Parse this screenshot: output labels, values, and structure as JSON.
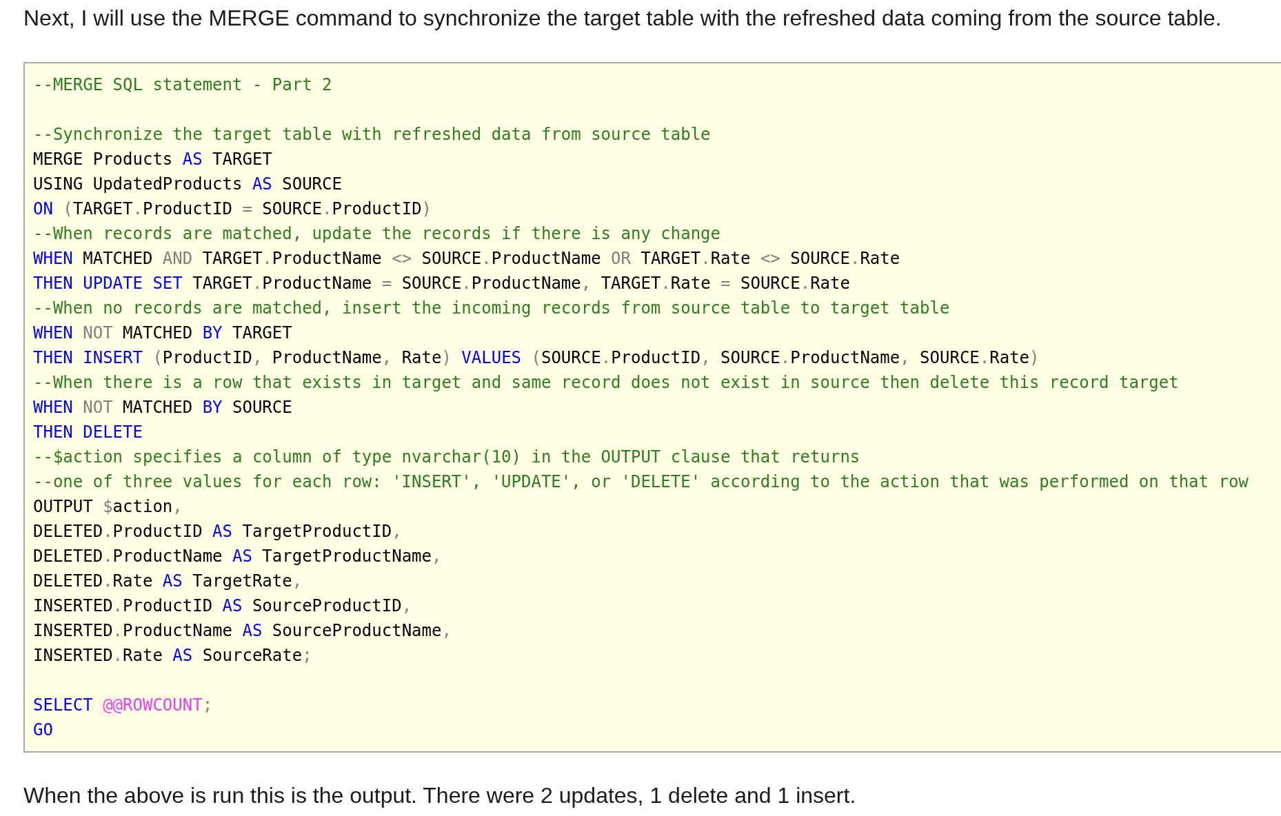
{
  "intro": "Next, I will use the MERGE command to synchronize the target table with the refreshed data coming from the source table.",
  "code_lines": [
    {
      "kind": "code",
      "tokens": [
        {
          "kind": "comment",
          "text": "--MERGE SQL statement - Part 2"
        }
      ]
    },
    {
      "kind": "blank"
    },
    {
      "kind": "code",
      "tokens": [
        {
          "kind": "comment",
          "text": "--Synchronize the target table with refreshed data from source table"
        }
      ]
    },
    {
      "kind": "code",
      "tokens": [
        {
          "kind": "plain",
          "text": "MERGE Products "
        },
        {
          "kind": "keyword",
          "text": "AS"
        },
        {
          "kind": "plain",
          "text": " TARGET"
        }
      ]
    },
    {
      "kind": "code",
      "tokens": [
        {
          "kind": "plain",
          "text": "USING UpdatedProducts "
        },
        {
          "kind": "keyword",
          "text": "AS"
        },
        {
          "kind": "plain",
          "text": " SOURCE"
        }
      ]
    },
    {
      "kind": "code",
      "tokens": [
        {
          "kind": "keyword",
          "text": "ON"
        },
        {
          "kind": "operator",
          "text": " ("
        },
        {
          "kind": "plain",
          "text": "TARGET"
        },
        {
          "kind": "operator",
          "text": "."
        },
        {
          "kind": "plain",
          "text": "ProductID "
        },
        {
          "kind": "operator",
          "text": "="
        },
        {
          "kind": "plain",
          "text": " SOURCE"
        },
        {
          "kind": "operator",
          "text": "."
        },
        {
          "kind": "plain",
          "text": "ProductID"
        },
        {
          "kind": "operator",
          "text": ")"
        }
      ]
    },
    {
      "kind": "code",
      "tokens": [
        {
          "kind": "comment",
          "text": "--When records are matched, update the records if there is any change"
        }
      ]
    },
    {
      "kind": "code",
      "tokens": [
        {
          "kind": "keyword",
          "text": "WHEN"
        },
        {
          "kind": "plain",
          "text": " MATCHED "
        },
        {
          "kind": "operator",
          "text": "AND"
        },
        {
          "kind": "plain",
          "text": " TARGET"
        },
        {
          "kind": "operator",
          "text": "."
        },
        {
          "kind": "plain",
          "text": "ProductName "
        },
        {
          "kind": "operator",
          "text": "<>"
        },
        {
          "kind": "plain",
          "text": " SOURCE"
        },
        {
          "kind": "operator",
          "text": "."
        },
        {
          "kind": "plain",
          "text": "ProductName "
        },
        {
          "kind": "operator",
          "text": "OR"
        },
        {
          "kind": "plain",
          "text": " TARGET"
        },
        {
          "kind": "operator",
          "text": "."
        },
        {
          "kind": "plain",
          "text": "Rate "
        },
        {
          "kind": "operator",
          "text": "<>"
        },
        {
          "kind": "plain",
          "text": " SOURCE"
        },
        {
          "kind": "operator",
          "text": "."
        },
        {
          "kind": "plain",
          "text": "Rate"
        }
      ]
    },
    {
      "kind": "code",
      "tokens": [
        {
          "kind": "keyword",
          "text": "THEN UPDATE SET"
        },
        {
          "kind": "plain",
          "text": " TARGET"
        },
        {
          "kind": "operator",
          "text": "."
        },
        {
          "kind": "plain",
          "text": "ProductName "
        },
        {
          "kind": "operator",
          "text": "="
        },
        {
          "kind": "plain",
          "text": " SOURCE"
        },
        {
          "kind": "operator",
          "text": "."
        },
        {
          "kind": "plain",
          "text": "ProductName"
        },
        {
          "kind": "operator",
          "text": ","
        },
        {
          "kind": "plain",
          "text": " TARGET"
        },
        {
          "kind": "operator",
          "text": "."
        },
        {
          "kind": "plain",
          "text": "Rate "
        },
        {
          "kind": "operator",
          "text": "="
        },
        {
          "kind": "plain",
          "text": " SOURCE"
        },
        {
          "kind": "operator",
          "text": "."
        },
        {
          "kind": "plain",
          "text": "Rate"
        }
      ]
    },
    {
      "kind": "code",
      "tokens": [
        {
          "kind": "comment",
          "text": "--When no records are matched, insert the incoming records from source table to target table"
        }
      ]
    },
    {
      "kind": "code",
      "tokens": [
        {
          "kind": "keyword",
          "text": "WHEN"
        },
        {
          "kind": "operator",
          "text": " NOT"
        },
        {
          "kind": "plain",
          "text": " MATCHED "
        },
        {
          "kind": "keyword",
          "text": "BY"
        },
        {
          "kind": "plain",
          "text": " TARGET"
        }
      ]
    },
    {
      "kind": "code",
      "tokens": [
        {
          "kind": "keyword",
          "text": "THEN INSERT"
        },
        {
          "kind": "operator",
          "text": " ("
        },
        {
          "kind": "plain",
          "text": "ProductID"
        },
        {
          "kind": "operator",
          "text": ","
        },
        {
          "kind": "plain",
          "text": " ProductName"
        },
        {
          "kind": "operator",
          "text": ","
        },
        {
          "kind": "plain",
          "text": " Rate"
        },
        {
          "kind": "operator",
          "text": ")"
        },
        {
          "kind": "keyword",
          "text": " VALUES"
        },
        {
          "kind": "operator",
          "text": " ("
        },
        {
          "kind": "plain",
          "text": "SOURCE"
        },
        {
          "kind": "operator",
          "text": "."
        },
        {
          "kind": "plain",
          "text": "ProductID"
        },
        {
          "kind": "operator",
          "text": ","
        },
        {
          "kind": "plain",
          "text": " SOURCE"
        },
        {
          "kind": "operator",
          "text": "."
        },
        {
          "kind": "plain",
          "text": "ProductName"
        },
        {
          "kind": "operator",
          "text": ","
        },
        {
          "kind": "plain",
          "text": " SOURCE"
        },
        {
          "kind": "operator",
          "text": "."
        },
        {
          "kind": "plain",
          "text": "Rate"
        },
        {
          "kind": "operator",
          "text": ")"
        }
      ]
    },
    {
      "kind": "code",
      "tokens": [
        {
          "kind": "comment",
          "text": "--When there is a row that exists in target and same record does not exist in source then delete this record target"
        }
      ]
    },
    {
      "kind": "code",
      "tokens": [
        {
          "kind": "keyword",
          "text": "WHEN"
        },
        {
          "kind": "operator",
          "text": " NOT"
        },
        {
          "kind": "plain",
          "text": " MATCHED "
        },
        {
          "kind": "keyword",
          "text": "BY"
        },
        {
          "kind": "plain",
          "text": " SOURCE"
        }
      ]
    },
    {
      "kind": "code",
      "tokens": [
        {
          "kind": "keyword",
          "text": "THEN DELETE"
        }
      ]
    },
    {
      "kind": "code",
      "tokens": [
        {
          "kind": "comment",
          "text": "--$action specifies a column of type nvarchar(10) in the OUTPUT clause that returns"
        }
      ]
    },
    {
      "kind": "code",
      "tokens": [
        {
          "kind": "comment",
          "text": "--one of three values for each row: 'INSERT', 'UPDATE', or 'DELETE' according to the action that was performed on that row"
        }
      ]
    },
    {
      "kind": "code",
      "tokens": [
        {
          "kind": "plain",
          "text": "OUTPUT "
        },
        {
          "kind": "operator",
          "text": "$"
        },
        {
          "kind": "plain",
          "text": "action"
        },
        {
          "kind": "operator",
          "text": ","
        }
      ]
    },
    {
      "kind": "code",
      "tokens": [
        {
          "kind": "plain",
          "text": "DELETED"
        },
        {
          "kind": "operator",
          "text": "."
        },
        {
          "kind": "plain",
          "text": "ProductID "
        },
        {
          "kind": "keyword",
          "text": "AS"
        },
        {
          "kind": "plain",
          "text": " TargetProductID"
        },
        {
          "kind": "operator",
          "text": ","
        }
      ]
    },
    {
      "kind": "code",
      "tokens": [
        {
          "kind": "plain",
          "text": "DELETED"
        },
        {
          "kind": "operator",
          "text": "."
        },
        {
          "kind": "plain",
          "text": "ProductName "
        },
        {
          "kind": "keyword",
          "text": "AS"
        },
        {
          "kind": "plain",
          "text": " TargetProductName"
        },
        {
          "kind": "operator",
          "text": ","
        }
      ]
    },
    {
      "kind": "code",
      "tokens": [
        {
          "kind": "plain",
          "text": "DELETED"
        },
        {
          "kind": "operator",
          "text": "."
        },
        {
          "kind": "plain",
          "text": "Rate "
        },
        {
          "kind": "keyword",
          "text": "AS"
        },
        {
          "kind": "plain",
          "text": " TargetRate"
        },
        {
          "kind": "operator",
          "text": ","
        }
      ]
    },
    {
      "kind": "code",
      "tokens": [
        {
          "kind": "plain",
          "text": "INSERTED"
        },
        {
          "kind": "operator",
          "text": "."
        },
        {
          "kind": "plain",
          "text": "ProductID "
        },
        {
          "kind": "keyword",
          "text": "AS"
        },
        {
          "kind": "plain",
          "text": " SourceProductID"
        },
        {
          "kind": "operator",
          "text": ","
        }
      ]
    },
    {
      "kind": "code",
      "tokens": [
        {
          "kind": "plain",
          "text": "INSERTED"
        },
        {
          "kind": "operator",
          "text": "."
        },
        {
          "kind": "plain",
          "text": "ProductName "
        },
        {
          "kind": "keyword",
          "text": "AS"
        },
        {
          "kind": "plain",
          "text": " SourceProductName"
        },
        {
          "kind": "operator",
          "text": ","
        }
      ]
    },
    {
      "kind": "code",
      "tokens": [
        {
          "kind": "plain",
          "text": "INSERTED"
        },
        {
          "kind": "operator",
          "text": "."
        },
        {
          "kind": "plain",
          "text": "Rate "
        },
        {
          "kind": "keyword",
          "text": "AS"
        },
        {
          "kind": "plain",
          "text": " SourceRate"
        },
        {
          "kind": "operator",
          "text": ";"
        }
      ]
    },
    {
      "kind": "blank"
    },
    {
      "kind": "code",
      "tokens": [
        {
          "kind": "keyword",
          "text": "SELECT"
        },
        {
          "kind": "variable",
          "text": " @@ROWCOUNT"
        },
        {
          "kind": "operator",
          "text": ";"
        }
      ]
    },
    {
      "kind": "code",
      "tokens": [
        {
          "kind": "keyword",
          "text": "GO"
        }
      ]
    }
  ],
  "outro": "When the above is run this is the output. There were 2 updates, 1 delete and 1 insert."
}
